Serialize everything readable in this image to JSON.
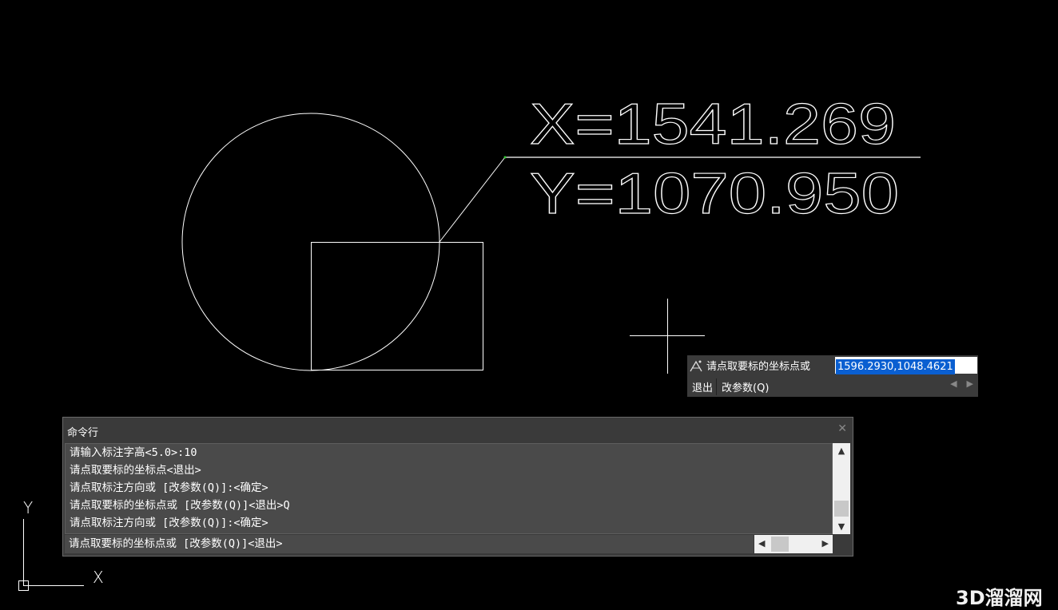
{
  "drawing": {
    "coord_label_x": "X=1541.269",
    "coord_label_y": "Y=1070.950"
  },
  "ucs": {
    "x_label": "X",
    "y_label": "Y"
  },
  "dynamic_prompt": {
    "label": "请点取要标的坐标点或",
    "value": "1596.2930,1048.4621",
    "options": [
      "退出",
      "改参数(Q)"
    ]
  },
  "command_window": {
    "title": "命令行",
    "history": [
      "请输入标注字高<5.0>:10",
      "请点取要标的坐标点<退出>",
      "请点取标注方向或 [改参数(Q)]:<确定>",
      "请点取要标的坐标点或 [改参数(Q)]<退出>Q",
      "请点取标注方向或 [改参数(Q)]:<确定>"
    ],
    "current": "请点取要标的坐标点或 [改参数(Q)]<退出>"
  },
  "watermark": "3D溜溜网",
  "colors": {
    "background": "#000000",
    "linework": "#ffffff",
    "selection": "#0a5fd1"
  },
  "icons": [
    "crosshair-cursor",
    "dynamic-input-icon",
    "close-icon",
    "scroll-up-icon",
    "scroll-down-icon",
    "scroll-left-icon",
    "scroll-right-icon"
  ]
}
